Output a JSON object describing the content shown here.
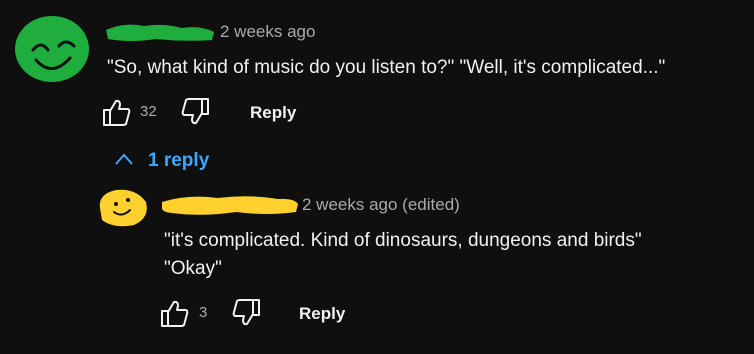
{
  "comment": {
    "timestamp": "2 weeks ago",
    "text": "\"So, what kind of music do you listen to?\"  \"Well, it's complicated...\"",
    "likes": "32",
    "reply_label": "Reply",
    "avatar_color": "#1fae3e",
    "redaction_color": "#1fae3e"
  },
  "replies_toggle": {
    "label": "1 reply",
    "icon": "chevron-up-icon"
  },
  "reply": {
    "timestamp": "2 weeks ago (edited)",
    "line1": "\"it's complicated. Kind of dinosaurs, dungeons and birds\"",
    "line2": "\"Okay\"",
    "likes": "3",
    "reply_label": "Reply",
    "avatar_color": "#ffd12e",
    "redaction_color": "#ffd12e"
  },
  "icons": {
    "like": "thumbs-up-icon",
    "dislike": "thumbs-down-icon"
  },
  "colors": {
    "background": "#0f0f0f",
    "link": "#3ea6ff",
    "secondary_text": "#aaaaaa"
  }
}
